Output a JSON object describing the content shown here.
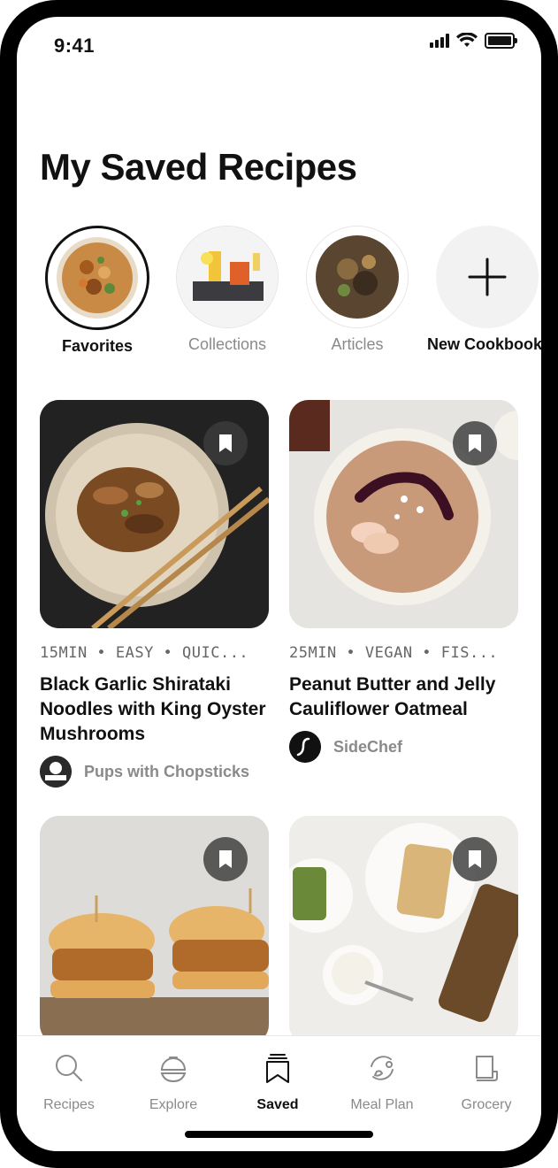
{
  "status": {
    "time": "9:41"
  },
  "page": {
    "title": "My Saved Recipes"
  },
  "cookbooks": [
    {
      "label": "Favorites"
    },
    {
      "label": "Collections"
    },
    {
      "label": "Articles"
    },
    {
      "label": "New Cookbook"
    }
  ],
  "recipes": [
    {
      "meta": "15MIN • EASY • QUIC...",
      "title": "Black Garlic Shirataki Noodles with King Oyster Mushrooms",
      "author": "Pups with Chopsticks"
    },
    {
      "meta": "25MIN • VEGAN • FIS...",
      "title": "Peanut Butter and Jelly Cauliflower Oatmeal",
      "author": "SideChef"
    },
    {
      "meta": "",
      "title": "",
      "author": ""
    },
    {
      "meta": "",
      "title": "",
      "author": ""
    }
  ],
  "tabs": [
    {
      "label": "Recipes",
      "icon": "search-icon"
    },
    {
      "label": "Explore",
      "icon": "cloche-icon"
    },
    {
      "label": "Saved",
      "icon": "saved-stack-icon",
      "active": true
    },
    {
      "label": "Meal Plan",
      "icon": "meal-plan-icon"
    },
    {
      "label": "Grocery",
      "icon": "grocery-icon"
    }
  ],
  "colors": {
    "text": "#111111",
    "muted": "#8a8a8a",
    "bookmark_bg": "#3c3c3c"
  }
}
